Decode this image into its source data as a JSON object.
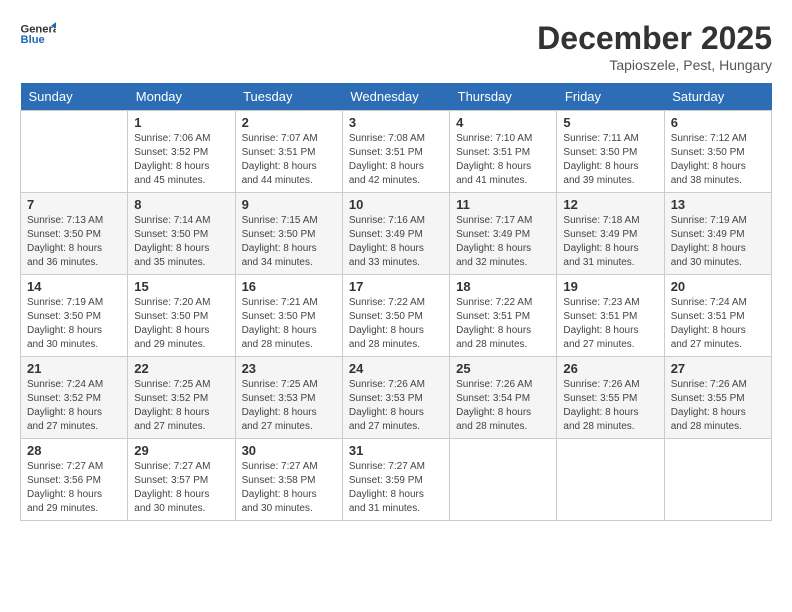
{
  "logo": {
    "line1": "General",
    "line2": "Blue"
  },
  "title": "December 2025",
  "location": "Tapioszele, Pest, Hungary",
  "weekdays": [
    "Sunday",
    "Monday",
    "Tuesday",
    "Wednesday",
    "Thursday",
    "Friday",
    "Saturday"
  ],
  "weeks": [
    [
      {
        "day": "",
        "sunrise": "",
        "sunset": "",
        "daylight": ""
      },
      {
        "day": "1",
        "sunrise": "Sunrise: 7:06 AM",
        "sunset": "Sunset: 3:52 PM",
        "daylight": "Daylight: 8 hours and 45 minutes."
      },
      {
        "day": "2",
        "sunrise": "Sunrise: 7:07 AM",
        "sunset": "Sunset: 3:51 PM",
        "daylight": "Daylight: 8 hours and 44 minutes."
      },
      {
        "day": "3",
        "sunrise": "Sunrise: 7:08 AM",
        "sunset": "Sunset: 3:51 PM",
        "daylight": "Daylight: 8 hours and 42 minutes."
      },
      {
        "day": "4",
        "sunrise": "Sunrise: 7:10 AM",
        "sunset": "Sunset: 3:51 PM",
        "daylight": "Daylight: 8 hours and 41 minutes."
      },
      {
        "day": "5",
        "sunrise": "Sunrise: 7:11 AM",
        "sunset": "Sunset: 3:50 PM",
        "daylight": "Daylight: 8 hours and 39 minutes."
      },
      {
        "day": "6",
        "sunrise": "Sunrise: 7:12 AM",
        "sunset": "Sunset: 3:50 PM",
        "daylight": "Daylight: 8 hours and 38 minutes."
      }
    ],
    [
      {
        "day": "7",
        "sunrise": "Sunrise: 7:13 AM",
        "sunset": "Sunset: 3:50 PM",
        "daylight": "Daylight: 8 hours and 36 minutes."
      },
      {
        "day": "8",
        "sunrise": "Sunrise: 7:14 AM",
        "sunset": "Sunset: 3:50 PM",
        "daylight": "Daylight: 8 hours and 35 minutes."
      },
      {
        "day": "9",
        "sunrise": "Sunrise: 7:15 AM",
        "sunset": "Sunset: 3:50 PM",
        "daylight": "Daylight: 8 hours and 34 minutes."
      },
      {
        "day": "10",
        "sunrise": "Sunrise: 7:16 AM",
        "sunset": "Sunset: 3:49 PM",
        "daylight": "Daylight: 8 hours and 33 minutes."
      },
      {
        "day": "11",
        "sunrise": "Sunrise: 7:17 AM",
        "sunset": "Sunset: 3:49 PM",
        "daylight": "Daylight: 8 hours and 32 minutes."
      },
      {
        "day": "12",
        "sunrise": "Sunrise: 7:18 AM",
        "sunset": "Sunset: 3:49 PM",
        "daylight": "Daylight: 8 hours and 31 minutes."
      },
      {
        "day": "13",
        "sunrise": "Sunrise: 7:19 AM",
        "sunset": "Sunset: 3:49 PM",
        "daylight": "Daylight: 8 hours and 30 minutes."
      }
    ],
    [
      {
        "day": "14",
        "sunrise": "Sunrise: 7:19 AM",
        "sunset": "Sunset: 3:50 PM",
        "daylight": "Daylight: 8 hours and 30 minutes."
      },
      {
        "day": "15",
        "sunrise": "Sunrise: 7:20 AM",
        "sunset": "Sunset: 3:50 PM",
        "daylight": "Daylight: 8 hours and 29 minutes."
      },
      {
        "day": "16",
        "sunrise": "Sunrise: 7:21 AM",
        "sunset": "Sunset: 3:50 PM",
        "daylight": "Daylight: 8 hours and 28 minutes."
      },
      {
        "day": "17",
        "sunrise": "Sunrise: 7:22 AM",
        "sunset": "Sunset: 3:50 PM",
        "daylight": "Daylight: 8 hours and 28 minutes."
      },
      {
        "day": "18",
        "sunrise": "Sunrise: 7:22 AM",
        "sunset": "Sunset: 3:51 PM",
        "daylight": "Daylight: 8 hours and 28 minutes."
      },
      {
        "day": "19",
        "sunrise": "Sunrise: 7:23 AM",
        "sunset": "Sunset: 3:51 PM",
        "daylight": "Daylight: 8 hours and 27 minutes."
      },
      {
        "day": "20",
        "sunrise": "Sunrise: 7:24 AM",
        "sunset": "Sunset: 3:51 PM",
        "daylight": "Daylight: 8 hours and 27 minutes."
      }
    ],
    [
      {
        "day": "21",
        "sunrise": "Sunrise: 7:24 AM",
        "sunset": "Sunset: 3:52 PM",
        "daylight": "Daylight: 8 hours and 27 minutes."
      },
      {
        "day": "22",
        "sunrise": "Sunrise: 7:25 AM",
        "sunset": "Sunset: 3:52 PM",
        "daylight": "Daylight: 8 hours and 27 minutes."
      },
      {
        "day": "23",
        "sunrise": "Sunrise: 7:25 AM",
        "sunset": "Sunset: 3:53 PM",
        "daylight": "Daylight: 8 hours and 27 minutes."
      },
      {
        "day": "24",
        "sunrise": "Sunrise: 7:26 AM",
        "sunset": "Sunset: 3:53 PM",
        "daylight": "Daylight: 8 hours and 27 minutes."
      },
      {
        "day": "25",
        "sunrise": "Sunrise: 7:26 AM",
        "sunset": "Sunset: 3:54 PM",
        "daylight": "Daylight: 8 hours and 28 minutes."
      },
      {
        "day": "26",
        "sunrise": "Sunrise: 7:26 AM",
        "sunset": "Sunset: 3:55 PM",
        "daylight": "Daylight: 8 hours and 28 minutes."
      },
      {
        "day": "27",
        "sunrise": "Sunrise: 7:26 AM",
        "sunset": "Sunset: 3:55 PM",
        "daylight": "Daylight: 8 hours and 28 minutes."
      }
    ],
    [
      {
        "day": "28",
        "sunrise": "Sunrise: 7:27 AM",
        "sunset": "Sunset: 3:56 PM",
        "daylight": "Daylight: 8 hours and 29 minutes."
      },
      {
        "day": "29",
        "sunrise": "Sunrise: 7:27 AM",
        "sunset": "Sunset: 3:57 PM",
        "daylight": "Daylight: 8 hours and 30 minutes."
      },
      {
        "day": "30",
        "sunrise": "Sunrise: 7:27 AM",
        "sunset": "Sunset: 3:58 PM",
        "daylight": "Daylight: 8 hours and 30 minutes."
      },
      {
        "day": "31",
        "sunrise": "Sunrise: 7:27 AM",
        "sunset": "Sunset: 3:59 PM",
        "daylight": "Daylight: 8 hours and 31 minutes."
      },
      {
        "day": "",
        "sunrise": "",
        "sunset": "",
        "daylight": ""
      },
      {
        "day": "",
        "sunrise": "",
        "sunset": "",
        "daylight": ""
      },
      {
        "day": "",
        "sunrise": "",
        "sunset": "",
        "daylight": ""
      }
    ]
  ]
}
